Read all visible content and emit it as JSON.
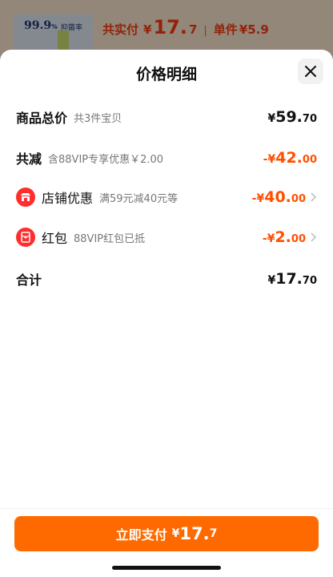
{
  "background": {
    "product_badge": "99.9",
    "product_badge_unit": "%",
    "product_badge_text": "抑菌率",
    "paid_label": "共实付",
    "paid_currency": "¥",
    "paid_int": "17.",
    "paid_dec": "7",
    "separator": "|",
    "unit_label": "单件",
    "unit_price": "¥5.9"
  },
  "sheet": {
    "title": "价格明细",
    "close_icon": "close-icon"
  },
  "rows": {
    "total": {
      "label": "商品总价",
      "sub": "共3件宝贝",
      "currency": "¥",
      "int": "59.",
      "dec": "70"
    },
    "discount": {
      "label": "共减",
      "sub": "含88VIP专享优惠￥2.00",
      "currency": "-¥",
      "int": "42.",
      "dec": "00"
    },
    "store": {
      "label": "店铺优惠",
      "sub": "满59元减40元等",
      "currency": "-¥",
      "int": "40.",
      "dec": "00",
      "icon": "store-icon"
    },
    "redpacket": {
      "label": "红包",
      "sub": "88VIP红包已抵",
      "currency": "-¥",
      "int": "2.",
      "dec": "00",
      "icon": "red-packet-icon"
    },
    "sum": {
      "label": "合计",
      "currency": "¥",
      "int": "17.",
      "dec": "70"
    }
  },
  "pay_button": {
    "label": "立即支付",
    "currency": "¥",
    "int": "17.",
    "dec": "7"
  },
  "colors": {
    "accent": "#ff5000",
    "button": "#ff6a00",
    "icon_red": "#ff2d2d"
  }
}
